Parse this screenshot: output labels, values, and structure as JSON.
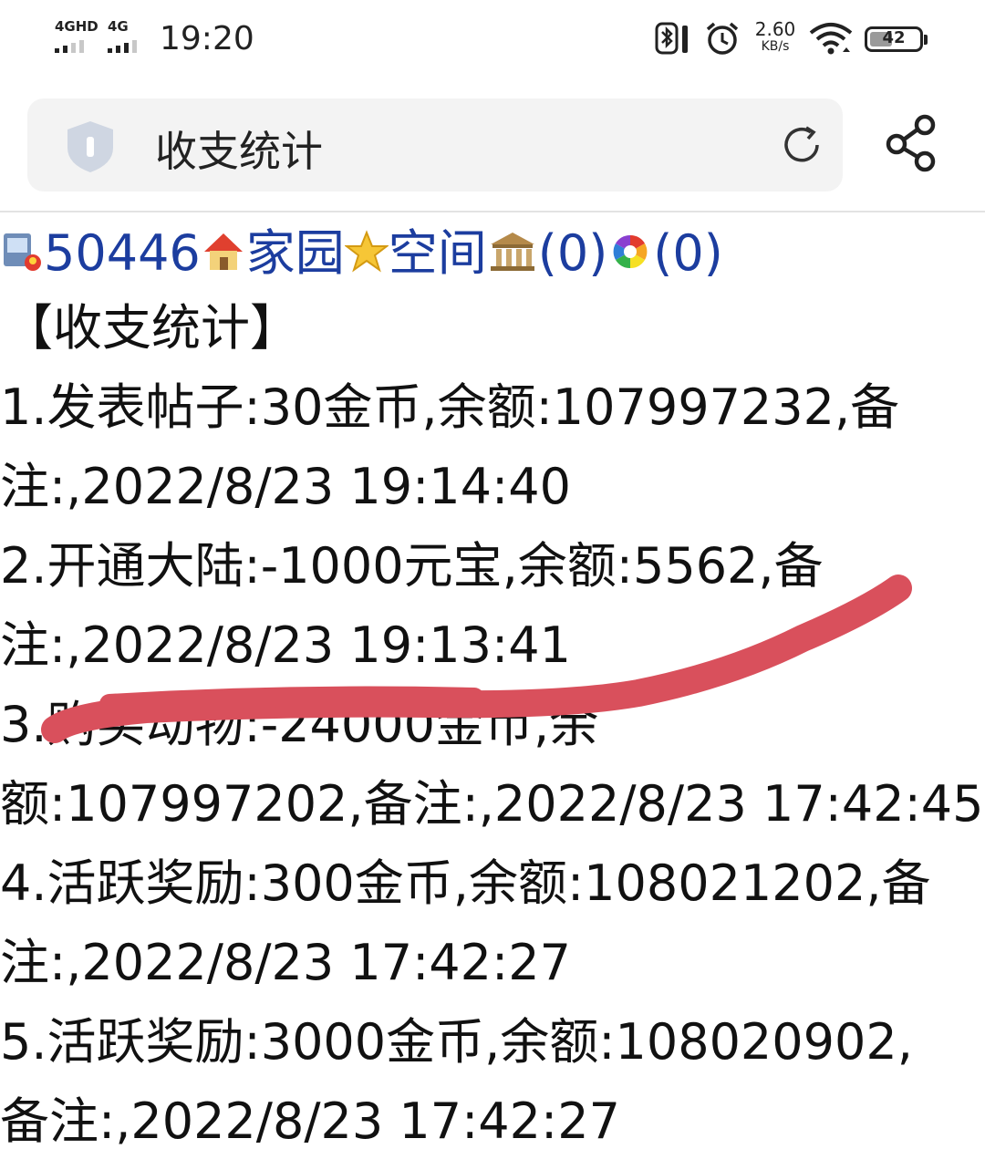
{
  "status_bar": {
    "sim1_label": "4GHD",
    "sim2_label": "4G",
    "time": "19:20",
    "net_speed_value": "2.60",
    "net_speed_unit": "KB/s",
    "battery_level": "42"
  },
  "address_bar": {
    "title": "收支统计"
  },
  "nav": {
    "user_id": "50446",
    "home_label": "家园",
    "space_label": "空间",
    "bank_count": "(0)",
    "color_count": "(0)"
  },
  "main": {
    "section_title": "【收支统计】",
    "entries": [
      {
        "line1": "1.发表帖子:30金币,余额:107997232,备",
        "line2": "注:,2022/8/23 19:14:40"
      },
      {
        "line1": "2.开通大陆:-1000元宝,余额:5562,备",
        "line2": "注:,2022/8/23 19:13:41"
      },
      {
        "line1": "3.购买动物:-24000金币,余",
        "line2": "额:107997202,备注:,2022/8/23 17:42:45"
      },
      {
        "line1": "4.活跃奖励:300金币,余额:108021202,备",
        "line2": "注:,2022/8/23 17:42:27"
      },
      {
        "line1": "5.活跃奖励:3000金币,余额:108020902,",
        "line2": "备注:,2022/8/23 17:42:27"
      }
    ]
  },
  "colors": {
    "link": "#1c3d9f",
    "scribble": "#d9505c",
    "address_bg": "#f3f3f3"
  }
}
